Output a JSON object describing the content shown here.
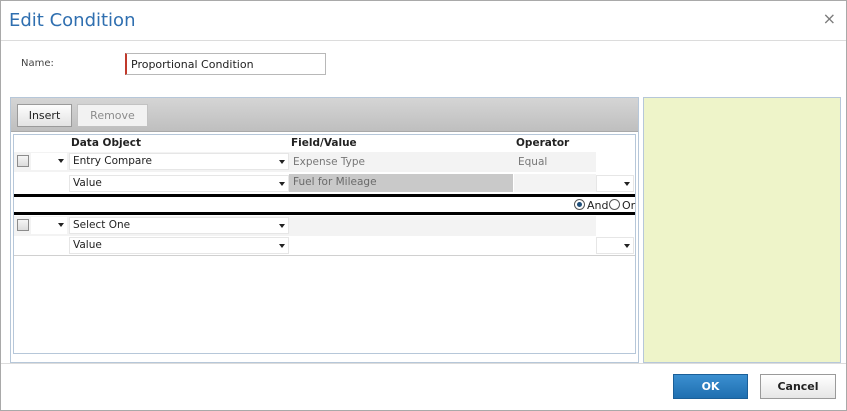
{
  "dialog": {
    "title": "Edit Condition",
    "close_glyph": "×"
  },
  "name_field": {
    "label": "Name:",
    "value": "Proportional Condition"
  },
  "toolbar": {
    "insert_label": "Insert",
    "remove_label": "Remove"
  },
  "grid": {
    "headers": {
      "data_object": "Data Object",
      "field_value": "Field/Value",
      "operator": "Operator"
    },
    "condition1": {
      "data_object": "Entry Compare",
      "field": "Expense Type",
      "operator": "Equal",
      "value_source": "Value",
      "value": "Fuel for Mileage"
    },
    "connector": {
      "and_label": "And",
      "or_label": "Or",
      "selected": "And"
    },
    "condition2": {
      "data_object": "Select One",
      "value_source": "Value"
    }
  },
  "footer": {
    "ok_label": "OK",
    "cancel_label": "Cancel"
  },
  "colors": {
    "accent": "#2f6fb0",
    "side_panel": "#eef4c9",
    "ok_button": "#1f6fb0"
  }
}
